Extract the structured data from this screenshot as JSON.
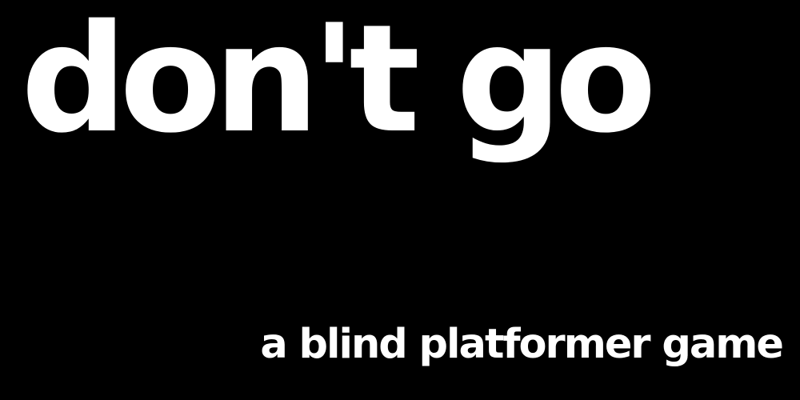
{
  "title": "don't go",
  "subtitle": "a blind platformer game",
  "colors": {
    "background": "#000000",
    "text": "#ffffff"
  }
}
